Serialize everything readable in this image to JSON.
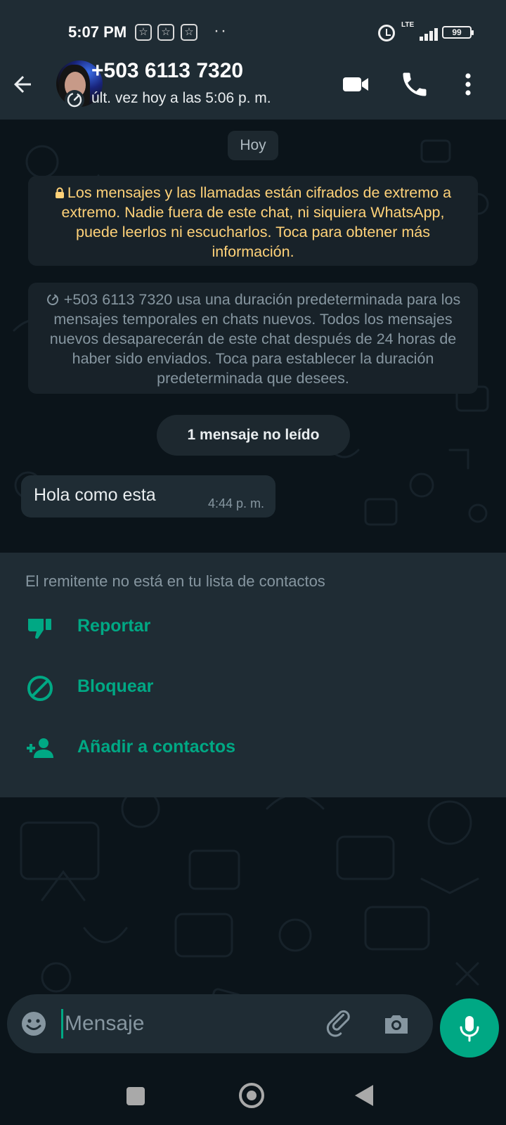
{
  "status_bar": {
    "time": "5:07 PM",
    "network": "LTE",
    "battery": "99"
  },
  "header": {
    "contact_name": "+503 6113 7320",
    "last_seen": "últ. vez hoy a las 5:06 p. m."
  },
  "chat": {
    "date_chip": "Hoy",
    "encryption_notice": "Los mensajes y las llamadas están cifrados de extremo a extremo. Nadie fuera de este chat, ni siquiera WhatsApp, puede leerlos ni escucharlos. Toca para obtener más información.",
    "disappearing_notice": "+503 6113 7320 usa una duración predeterminada para los mensajes temporales en chats nuevos. Todos los mensajes nuevos desaparecerán de este chat después de 24 horas de haber sido enviados. Toca para establecer la duración predeterminada que desees.",
    "unread_label": "1 mensaje no leído",
    "messages": [
      {
        "text": "Hola como esta",
        "time": "4:44 p. m."
      }
    ]
  },
  "unknown_sender_panel": {
    "info": "El remitente no está en tu lista de contactos",
    "actions": [
      {
        "label": "Reportar",
        "icon": "thumbs-down-icon"
      },
      {
        "label": "Bloquear",
        "icon": "block-icon"
      },
      {
        "label": "Añadir a contactos",
        "icon": "add-person-icon"
      }
    ]
  },
  "input": {
    "placeholder": "Mensaje"
  },
  "colors": {
    "accent": "#00a884",
    "app_bar": "#1f2c34",
    "background": "#0b141a",
    "encryption_text": "#ffd279"
  }
}
